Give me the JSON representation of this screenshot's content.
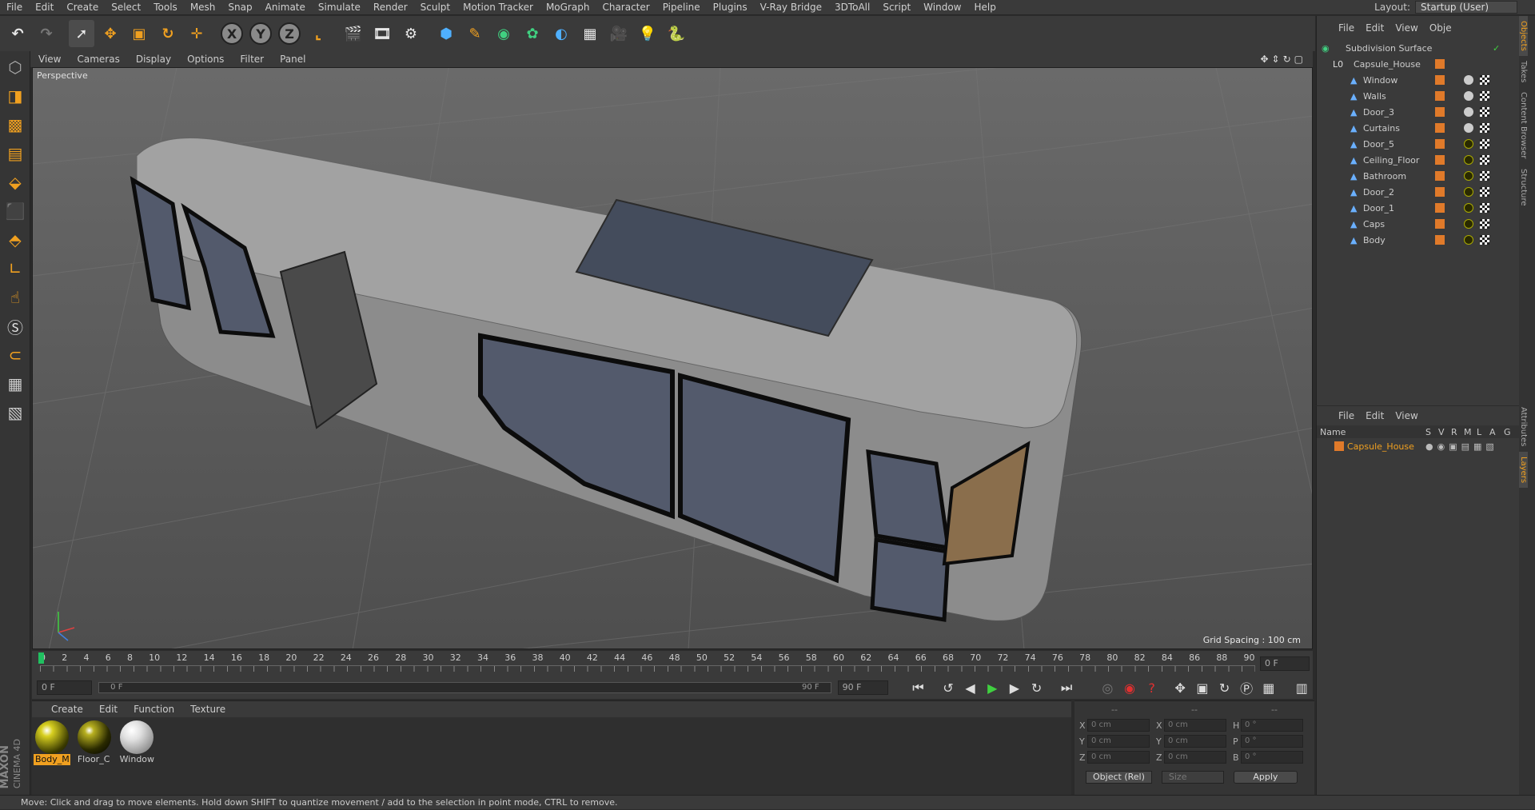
{
  "menubar": {
    "items": [
      "File",
      "Edit",
      "Create",
      "Select",
      "Tools",
      "Mesh",
      "Snap",
      "Animate",
      "Simulate",
      "Render",
      "Sculpt",
      "Motion Tracker",
      "MoGraph",
      "Character",
      "Pipeline",
      "Plugins",
      "V-Ray Bridge",
      "3DToAll",
      "Script",
      "Window",
      "Help"
    ],
    "layout_label": "Layout:",
    "layout_value": "Startup (User)"
  },
  "toolbar": {
    "icons": [
      "undo-icon",
      "redo-icon",
      "select-arrow-icon",
      "move-icon",
      "scale-icon",
      "rotate-icon",
      "live-select-icon",
      "x-axis-icon",
      "y-axis-icon",
      "z-axis-icon",
      "coordinate-system-icon",
      "render-view-icon",
      "render-picture-viewer-icon",
      "render-settings-icon",
      "cube-icon",
      "pen-icon",
      "subdivision-icon",
      "cloner-icon",
      "deformer-icon",
      "floor-icon",
      "camera-icon",
      "light-icon",
      "python-icon"
    ],
    "x_label": "X",
    "y_label": "Y",
    "z_label": "Z"
  },
  "viewport": {
    "menu": [
      "View",
      "Cameras",
      "Display",
      "Options",
      "Filter",
      "Panel"
    ],
    "label": "Perspective",
    "grid_spacing": "Grid Spacing : 100 cm"
  },
  "timeline": {
    "ticks": [
      "0",
      "2",
      "4",
      "6",
      "8",
      "10",
      "12",
      "14",
      "16",
      "18",
      "20",
      "22",
      "24",
      "26",
      "28",
      "30",
      "32",
      "34",
      "36",
      "38",
      "40",
      "42",
      "44",
      "46",
      "48",
      "50",
      "52",
      "54",
      "56",
      "58",
      "60",
      "62",
      "64",
      "66",
      "68",
      "70",
      "72",
      "74",
      "76",
      "78",
      "80",
      "82",
      "84",
      "86",
      "88",
      "90"
    ],
    "current_frame": "0 F",
    "start": "0 F",
    "slider_start": "0 F",
    "slider_end": "90 F",
    "end": "90 F"
  },
  "materials": {
    "menu": [
      "Create",
      "Edit",
      "Function",
      "Texture"
    ],
    "items": [
      {
        "label": "Body_M",
        "color": "#c8c020"
      },
      {
        "label": "Floor_C",
        "color": "#3a3a10"
      },
      {
        "label": "Window",
        "color": "#d8d8d8"
      }
    ]
  },
  "coordinates": {
    "header": [
      "--",
      "--",
      "--"
    ],
    "rows": [
      {
        "a": "X",
        "av": "0 cm",
        "b": "X",
        "bv": "0 cm",
        "c": "H",
        "cv": "0 °"
      },
      {
        "a": "Y",
        "av": "0 cm",
        "b": "Y",
        "bv": "0 cm",
        "c": "P",
        "cv": "0 °"
      },
      {
        "a": "Z",
        "av": "0 cm",
        "b": "Z",
        "bv": "0 cm",
        "c": "B",
        "cv": "0 °"
      }
    ],
    "mode": "Object (Rel)",
    "size": "Size",
    "apply": "Apply"
  },
  "objects": {
    "menu": [
      "File",
      "Edit",
      "View",
      "Obje"
    ],
    "root": "Subdivision Surface",
    "group": "Capsule_House",
    "children": [
      "Window",
      "Walls",
      "Door_3",
      "Curtains",
      "Door_5",
      "Ceiling_Floor",
      "Bathroom",
      "Door_2",
      "Door_1",
      "Caps",
      "Body"
    ]
  },
  "attributes": {
    "menu": [
      "File",
      "Edit",
      "View"
    ],
    "columns": [
      "Name",
      "S",
      "V",
      "R",
      "M",
      "L",
      "A",
      "G"
    ],
    "layer": "Capsule_House"
  },
  "side_tabs": [
    "Objects",
    "Takes",
    "Content Browser",
    "Structure",
    "Attributes",
    "Layers"
  ],
  "brand": {
    "maxon": "MAXON",
    "product": "CINEMA 4D"
  },
  "status": "Move: Click and drag to move elements. Hold down SHIFT to quantize movement / add to the selection in point mode, CTRL to remove.",
  "colors": {
    "accent": "#f0a020",
    "layer_orange": "#e07a2a",
    "viewport_bg": "#5a5a5a"
  }
}
